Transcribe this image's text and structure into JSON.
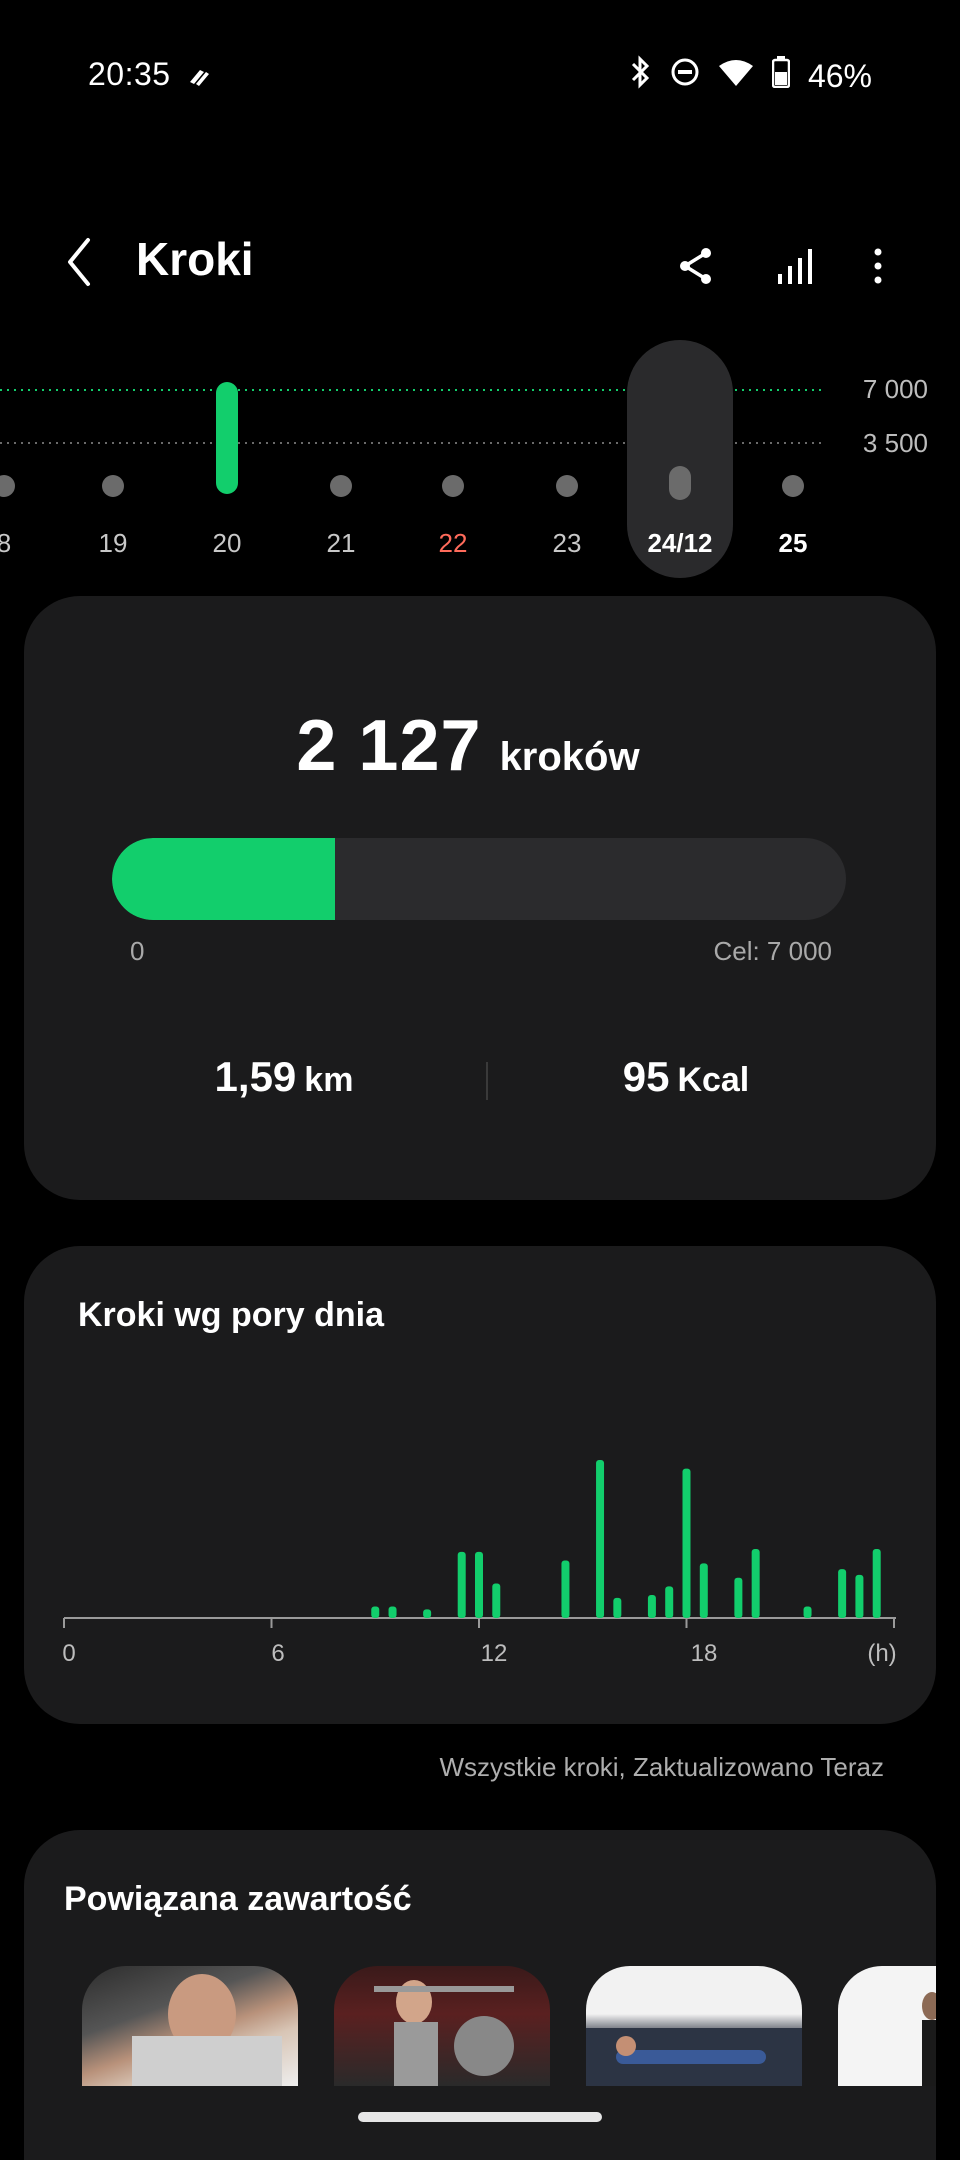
{
  "status_bar": {
    "time": "20:35",
    "battery": "46%",
    "icons": [
      "payment-icon",
      "bluetooth-icon",
      "do-not-disturb-icon",
      "wifi-icon",
      "battery-icon"
    ]
  },
  "header": {
    "title": "Kroki",
    "icons": [
      "back-icon",
      "share-icon",
      "bar-chart-icon",
      "more-icon"
    ]
  },
  "week_strip": {
    "days": [
      {
        "label": "8",
        "steps": 0,
        "partial": true
      },
      {
        "label": "19",
        "steps": 0
      },
      {
        "label": "20",
        "steps": 7000
      },
      {
        "label": "21",
        "steps": 0
      },
      {
        "label": "22",
        "steps": 0,
        "color": "#ff6b5b"
      },
      {
        "label": "23",
        "steps": 0
      },
      {
        "label": "24/12",
        "steps": 0,
        "selected": true
      },
      {
        "label": "25",
        "steps": 0,
        "bold": true
      }
    ],
    "goal_labels": [
      "7 000",
      "3 500"
    ],
    "goal_color": "#12ce6c"
  },
  "summary": {
    "steps": "2 127",
    "steps_unit": "kroków",
    "progress_fraction": 0.304,
    "progress_min": "0",
    "progress_goal": "Cel: 7 000",
    "distance_value": "1,59",
    "distance_unit": "km",
    "calories_value": "95",
    "calories_unit": "Kcal"
  },
  "by_time_of_day": {
    "title": "Kroki wg pory dnia",
    "axis_labels": [
      "0",
      "6",
      "12",
      "18",
      "(h)"
    ],
    "footnote": "Wszystkie kroki, Zaktualizowano Teraz"
  },
  "chart_data": {
    "type": "bar",
    "title": "Kroki wg pory dnia",
    "xlabel": "(h)",
    "xlim": [
      0,
      24
    ],
    "x_ticks": [
      "0",
      "6",
      "12",
      "18"
    ],
    "x": [
      9.0,
      9.5,
      10.5,
      11.5,
      12.0,
      12.5,
      14.5,
      15.5,
      16.0,
      17.0,
      17.5,
      18.0,
      18.5,
      19.5,
      20.0,
      21.5,
      22.5,
      23.0,
      23.5
    ],
    "values": [
      8,
      8,
      6,
      46,
      46,
      24,
      40,
      110,
      14,
      16,
      22,
      104,
      38,
      28,
      48,
      8,
      34,
      30,
      48
    ]
  },
  "related": {
    "title": "Powiązana zawartość",
    "thumbnails": [
      "workout-photo-1",
      "workout-photo-2",
      "workout-photo-3",
      "workout-photo-4"
    ]
  },
  "colors": {
    "accent": "#12ce6c",
    "card": "#1b1b1c",
    "background": "#000000"
  }
}
